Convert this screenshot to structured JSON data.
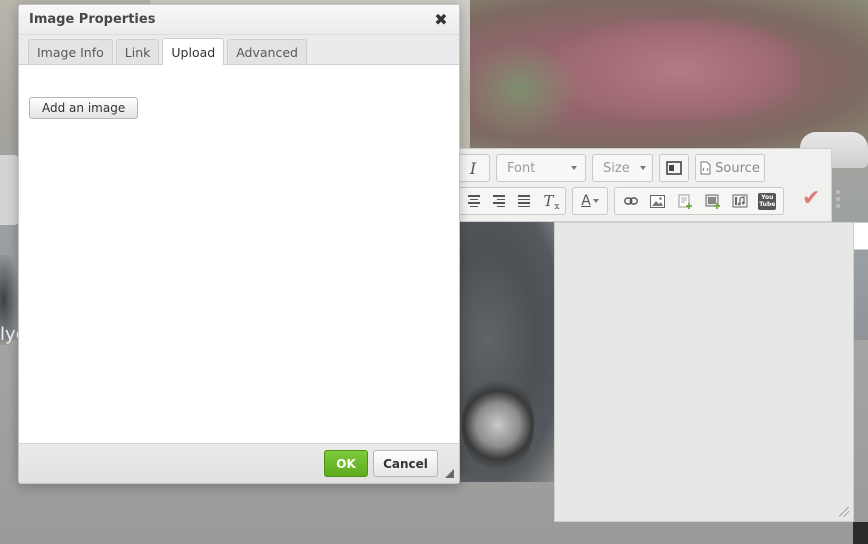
{
  "background": {
    "text_fragment": "lyc"
  },
  "editor": {
    "toolbar": {
      "italic_label": "I",
      "font_combo": "Font",
      "size_combo": "Size",
      "source_label": "Source",
      "text_color_label": "A",
      "icons": [
        "italic-icon",
        "show-blocks-icon",
        "source-icon",
        "align-center-icon",
        "align-right-icon",
        "align-justify-icon",
        "remove-format-icon",
        "text-color-icon",
        "link-icon",
        "image-icon",
        "add-file-icon",
        "add-image-icon",
        "media-icon",
        "youtube-icon"
      ],
      "youtube_label": "You Tube"
    },
    "check_mark": "✔"
  },
  "dialog": {
    "title": "Image Properties",
    "close_glyph": "✖",
    "tabs": [
      {
        "label": "Image Info",
        "active": false
      },
      {
        "label": "Link",
        "active": false
      },
      {
        "label": "Upload",
        "active": true
      },
      {
        "label": "Advanced",
        "active": false
      }
    ],
    "upload": {
      "add_image_label": "Add an image"
    },
    "footer": {
      "ok_label": "OK",
      "cancel_label": "Cancel"
    }
  },
  "colors": {
    "ok_green": "#6cba2a",
    "dialog_chrome": "#ebebeb",
    "check_red": "#e07b7b"
  }
}
